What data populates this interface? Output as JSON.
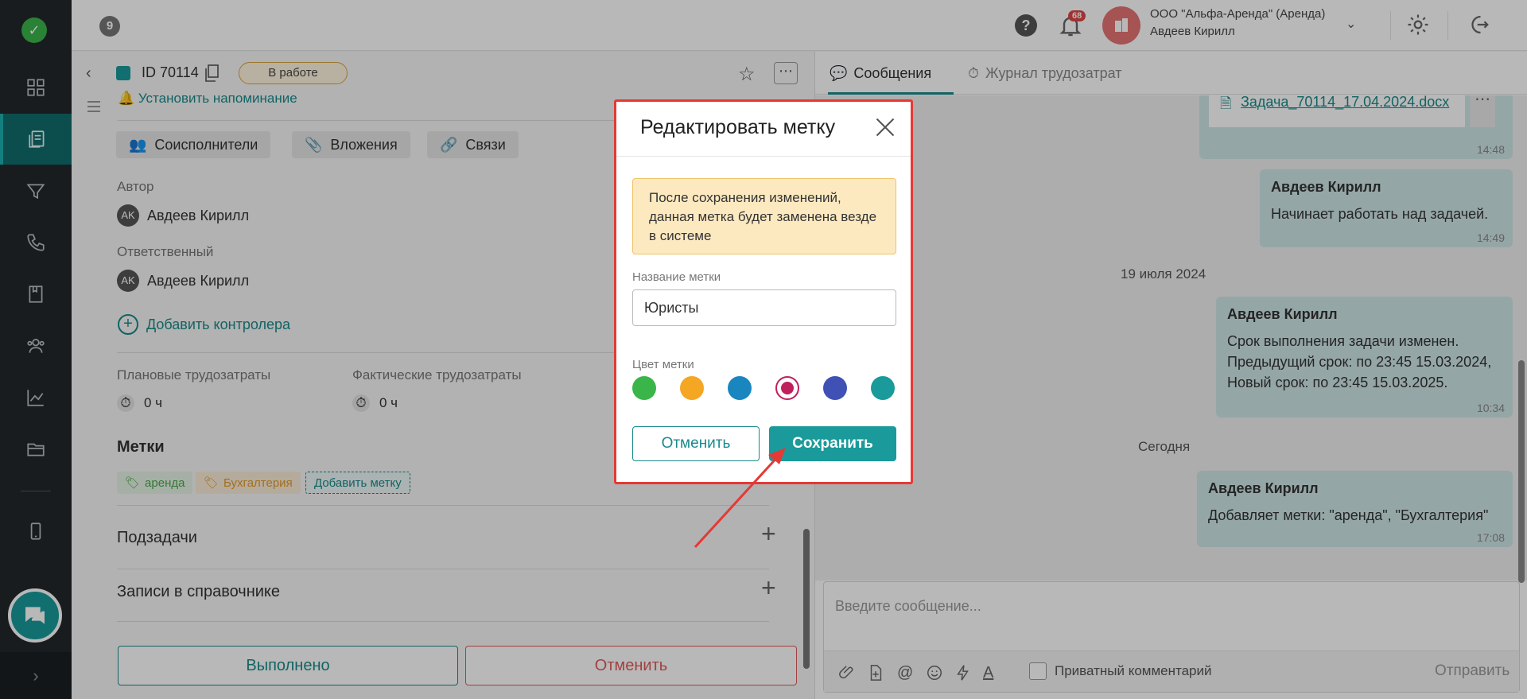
{
  "topbar": {
    "badge": "9",
    "help": "?",
    "notifications": "68",
    "org_name": "ООО \"Альфа-Аренда\" (Аренда)",
    "user_name": "Авдеев Кирилл"
  },
  "task": {
    "id": "ID 70114",
    "status": "В работе",
    "reminder": "Установить напоминание",
    "chips": [
      "Соисполнители",
      "Вложения",
      "Связи"
    ],
    "author_label": "Автор",
    "author_initials": "AK",
    "author_name": "Авдеев Кирилл",
    "resp_label": "Ответственный",
    "resp_initials": "AK",
    "resp_name": "Авдеев Кирилл",
    "add_controller": "Добавить контролера",
    "planned_label": "Плановые трудозатраты",
    "planned_value": "0 ч",
    "actual_label": "Фактические трудозатраты",
    "actual_value": "0 ч",
    "tags_title": "Метки",
    "tags": [
      "аренда",
      "Бухгалтерия"
    ],
    "add_tag": "Добавить метку",
    "subtasks": "Подзадачи",
    "directory": "Записи в справочнике",
    "btn_done": "Выполнено",
    "btn_cancel": "Отменить"
  },
  "chat": {
    "tab_messages": "Сообщения",
    "tab_log": "Журнал трудозатрат",
    "file_name": "Задача_70114_17.04.2024.docx",
    "file_time": "14:48",
    "msg1_name": "Авдеев Кирилл",
    "msg1_text": "Начинает работать над задачей.",
    "msg1_time": "14:49",
    "day1": "19 июля 2024",
    "msg2_name": "Авдеев Кирилл",
    "msg2_line1": "Срок выполнения задачи изменен.",
    "msg2_line2": "Предыдущий срок: по 23:45 15.03.2024,",
    "msg2_line3": "Новый срок: по 23:45 15.03.2025.",
    "msg2_time": "10:34",
    "day2": "Сегодня",
    "msg3_name": "Авдеев Кирилл",
    "msg3_text": "Добавляет метки: \"аренда\", \"Бухгалтерия\"",
    "msg3_time": "17:08",
    "composer_placeholder": "Введите сообщение...",
    "private_label": "Приватный комментарий",
    "send": "Отправить"
  },
  "modal": {
    "title": "Редактировать метку",
    "warning": "После сохранения изменений, данная метка будет заменена везде в системе",
    "name_label": "Название метки",
    "name_value": "Юристы",
    "color_label": "Цвет метки",
    "colors": [
      "#3ab54a",
      "#f5a623",
      "#1a86c0",
      "#c0205c",
      "#3f51b5",
      "#1a9a9a"
    ],
    "selected_color": "#c0205c",
    "cancel": "Отменить",
    "save": "Сохранить"
  },
  "colors": {
    "accent": "#1a9a9a",
    "danger": "#e53935"
  }
}
